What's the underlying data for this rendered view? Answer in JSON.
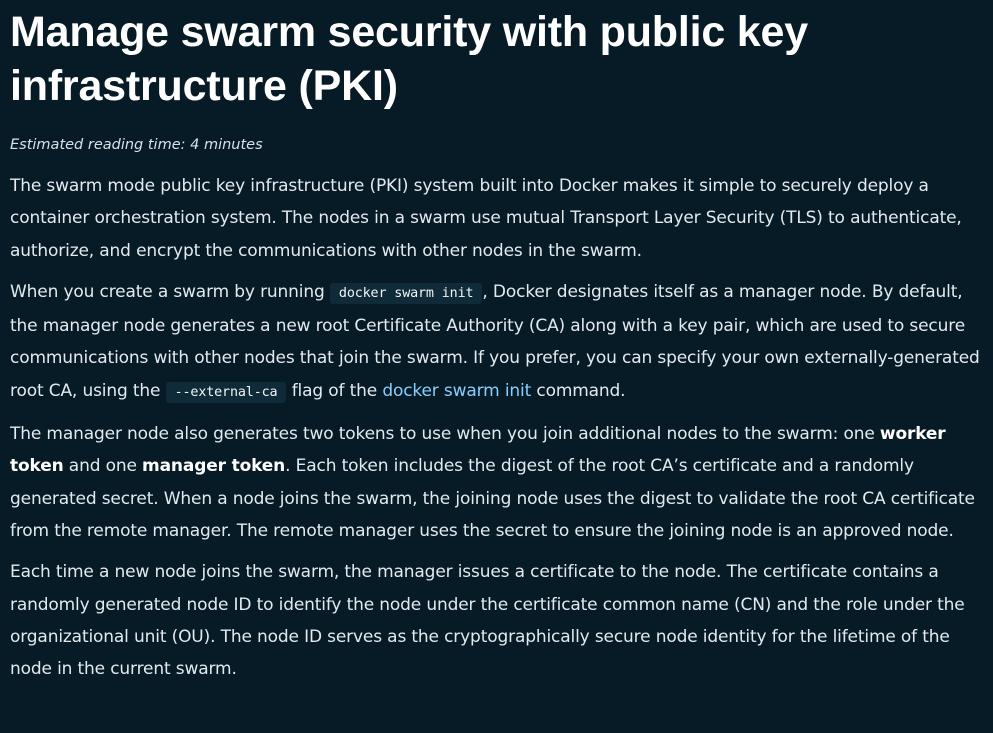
{
  "title": "Manage swarm security with public key infrastructure (PKI)",
  "reading_time": "Estimated reading time: 4 minutes",
  "paragraphs": {
    "p1": "The swarm mode public key infrastructure (PKI) system built into Docker makes it simple to securely deploy a container orchestration system. The nodes in a swarm use mutual Transport Layer Security (TLS) to authenticate, authorize, and encrypt the communications with other nodes in the swarm.",
    "p2": {
      "before_code1": "When you create a swarm by running ",
      "code1": "docker swarm init",
      "after_code1": ", Docker designates itself as a manager node. By default, the manager node generates a new root Certificate Authority (CA) along with a key pair, which are used to secure communications with other nodes that join the swarm. If you prefer, you can specify your own externally-generated root CA, using the ",
      "code2": "--external-ca",
      "after_code2": " flag of the ",
      "link": "docker swarm init",
      "after_link": " command."
    },
    "p3": {
      "text1": "The manager node also generates two tokens to use when you join additional nodes to the swarm: one ",
      "bold1": "worker token",
      "text2": " and one ",
      "bold2": "manager token",
      "text3": ". Each token includes the digest of the root CA’s certificate and a randomly generated secret. When a node joins the swarm, the joining node uses the digest to validate the root CA certificate from the remote manager. The remote manager uses the secret to ensure the joining node is an approved node."
    },
    "p4": "Each time a new node joins the swarm, the manager issues a certificate to the node. The certificate contains a randomly generated node ID to identify the node under the certificate common name (CN) and the role under the organizational unit (OU). The node ID serves as the cryptographically secure node identity for the lifetime of the node in the current swarm."
  },
  "colors": {
    "background": "#071b27",
    "text": "#e3eaee",
    "link": "#86cfff",
    "code_bg": "#0f2b39"
  }
}
